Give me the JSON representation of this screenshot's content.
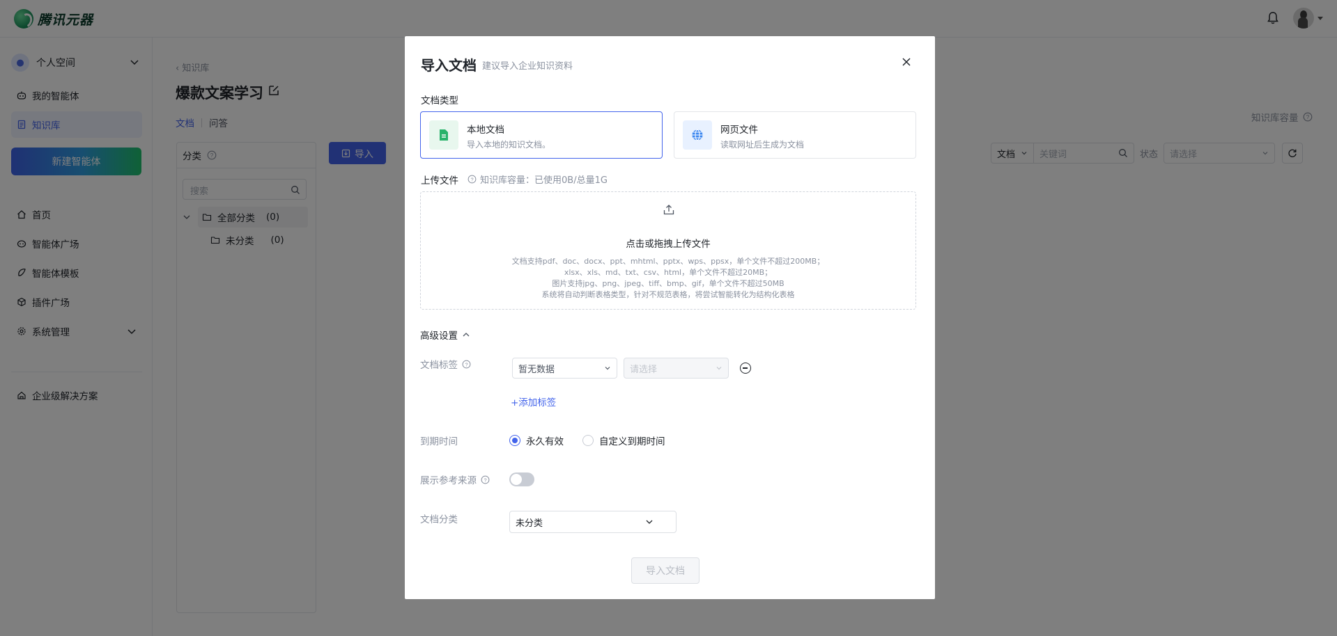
{
  "header": {
    "brand": "腾讯元器"
  },
  "sidebar": {
    "space_label": "个人空间",
    "items": [
      {
        "label": "我的智能体",
        "icon": "agent-icon"
      },
      {
        "label": "知识库",
        "icon": "book-icon",
        "active": true
      }
    ],
    "new_agent_label": "新建智能体",
    "nav": [
      {
        "label": "首页",
        "icon": "home-icon"
      },
      {
        "label": "智能体广场",
        "icon": "robot-icon"
      },
      {
        "label": "智能体模板",
        "icon": "template-icon"
      },
      {
        "label": "插件广场",
        "icon": "plugin-icon"
      },
      {
        "label": "系统管理",
        "icon": "gear-icon"
      }
    ],
    "enterprise_label": "企业级解决方案"
  },
  "main": {
    "breadcrumb": "知识库",
    "title": "爆款文案学习",
    "tabs": [
      "文档",
      "问答"
    ],
    "category_panel_title": "分类",
    "category_search_placeholder": "搜索",
    "tree": [
      {
        "label": "全部分类",
        "count": "(0)"
      },
      {
        "label": "未分类",
        "count": "(0)"
      }
    ],
    "import_label": "导入",
    "kb_capacity_label": "知识库容量",
    "filter": {
      "doc_select": "文档",
      "keyword_placeholder": "关键词",
      "status_label": "状态",
      "status_placeholder": "请选择"
    }
  },
  "modal": {
    "title": "导入文档",
    "subtitle": "建议导入企业知识资料",
    "doc_type_label": "文档类型",
    "types": [
      {
        "title": "本地文档",
        "desc": "导入本地的知识文档。",
        "selected": true
      },
      {
        "title": "网页文件",
        "desc": "读取网址后生成为文档",
        "selected": false
      }
    ],
    "upload_label": "上传文件",
    "upload_capacity": "知识库容量：已使用0B/总量1G",
    "dropzone": {
      "title": "点击或拖拽上传文件",
      "lines": [
        "文档支持pdf、doc、docx、ppt、mhtml、pptx、wps、ppsx，单个文件不超过200MB；",
        "xlsx、xls、md、txt、csv、html，单个文件不超过20MB；",
        "图片支持jpg、png、jpeg、tiff、bmp、gif，单个文件不超过50MB",
        "系统将自动判断表格类型，针对不规范表格，将尝试智能转化为结构化表格"
      ]
    },
    "advanced_label": "高级设置",
    "tag_label": "文档标签",
    "tag_select": "暂无数据",
    "tag_value_placeholder": "请选择",
    "add_tag_label": "+添加标签",
    "expiry_label": "到期时间",
    "expiry_options": [
      "永久有效",
      "自定义到期时间"
    ],
    "show_source_label": "展示参考来源",
    "show_source_enabled": false,
    "category_label": "文档分类",
    "category_value": "未分类",
    "submit_label": "导入文档"
  },
  "colors": {
    "accent": "#4263eb",
    "overlay": "rgba(0,0,0,0.5)"
  }
}
